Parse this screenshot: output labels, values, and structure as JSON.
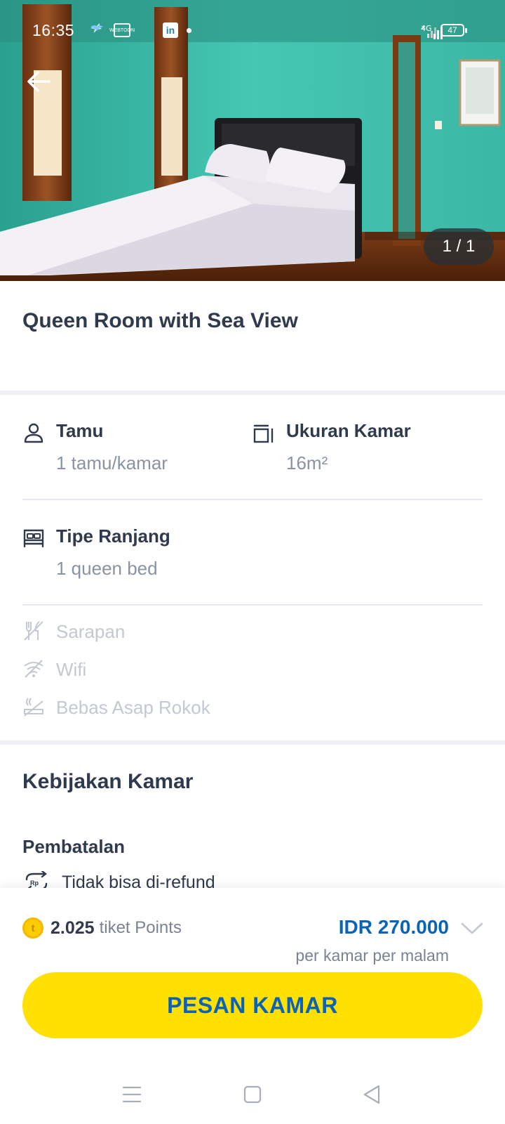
{
  "status_bar": {
    "time": "16:35",
    "battery": "47",
    "network": "4G",
    "left_icons": [
      "bird-icon",
      "webtoon-icon",
      "bluebird-icon",
      "linkedin-icon",
      "dot-icon"
    ],
    "webtoon_text": "WEBTOON",
    "linkedin_text": "in"
  },
  "gallery": {
    "counter": "1 / 1"
  },
  "room": {
    "title": "Queen Room with Sea View"
  },
  "features": {
    "guests_label": "Tamu",
    "guests_value": "1 tamu/kamar",
    "size_label": "Ukuran Kamar",
    "size_value": "16m²",
    "bed_label": "Tipe Ranjang",
    "bed_value": "1 queen bed"
  },
  "amenities": [
    {
      "label": "Sarapan",
      "icon": "no-breakfast-icon"
    },
    {
      "label": "Wifi",
      "icon": "no-wifi-icon"
    },
    {
      "label": "Bebas Asap Rokok",
      "icon": "no-smoking-icon"
    }
  ],
  "policy": {
    "title": "Kebijakan Kamar",
    "cancellation_title": "Pembatalan",
    "cancellation_text": "Tidak bisa di-refund"
  },
  "booking": {
    "points_value": "2.025",
    "points_unit": "tiket Points",
    "price": "IDR 270.000",
    "price_note": "per kamar per malam",
    "book_label": "PESAN KAMAR"
  },
  "colors": {
    "accent_blue": "#0b63b6",
    "button_yellow": "#ffe000",
    "text_dark": "#2f3a4d",
    "text_muted": "#8a93a3"
  }
}
